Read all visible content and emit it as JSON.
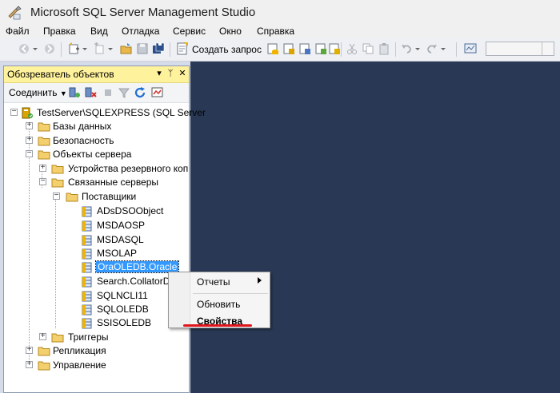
{
  "window": {
    "title": "Microsoft SQL Server Management Studio"
  },
  "menu": [
    "Файл",
    "Правка",
    "Вид",
    "Отладка",
    "Сервис",
    "Окно",
    "Справка"
  ],
  "toolbar": {
    "new_query": "Создать запрос"
  },
  "object_explorer": {
    "title": "Обозреватель объектов",
    "connect_label": "Соединить",
    "tree": {
      "server": "TestServer\\SQLEXPRESS (SQL Server",
      "databases": "Базы данных",
      "security": "Безопасность",
      "server_objects": "Объекты сервера",
      "backup_devices": "Устройства резервного копи",
      "linked_servers": "Связанные серверы",
      "providers": "Поставщики",
      "provider_items": [
        "ADsDSOObject",
        "MSDAOSP",
        "MSDASQL",
        "MSOLAP",
        "OraOLEDB.Oracle",
        "Search.CollatorD",
        "SQLNCLI11",
        "SQLOLEDB",
        "SSISOLEDB"
      ],
      "triggers": "Триггеры",
      "replication": "Репликация",
      "management": "Управление"
    }
  },
  "context_menu": {
    "reports": "Отчеты",
    "refresh": "Обновить",
    "properties": "Свойства"
  },
  "colors": {
    "workspace": "#293955",
    "panel_header": "#fff29d",
    "selection": "#3399ff",
    "highlight_underline": "#e0161c"
  }
}
